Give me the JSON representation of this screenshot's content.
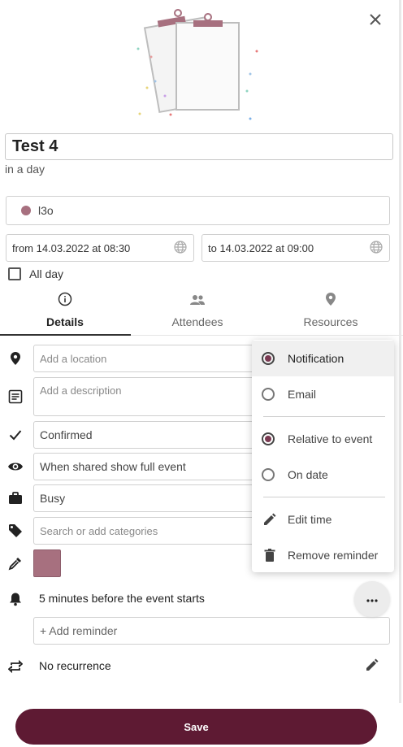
{
  "event": {
    "title": "Test 4",
    "relative_time": "in a day",
    "calendar_name": "l3o",
    "calendar_color": "#a7707f",
    "from": "from 14.03.2022 at 08:30",
    "to": "to 14.03.2022 at 09:00",
    "all_day_label": "All day"
  },
  "tabs": [
    {
      "label": "Details",
      "icon": "info-icon",
      "active": true
    },
    {
      "label": "Attendees",
      "icon": "people-icon",
      "active": false
    },
    {
      "label": "Resources",
      "icon": "location-pin-icon",
      "active": false
    }
  ],
  "details": {
    "location_placeholder": "Add a location",
    "description_placeholder": "Add a description",
    "status": "Confirmed",
    "visibility": "When shared show full event",
    "availability": "Busy",
    "categories_placeholder": "Search or add categories",
    "color": "#a7707f",
    "reminder": "5 minutes before the event starts",
    "add_reminder": "+ Add reminder",
    "recurrence": "No recurrence"
  },
  "menu": {
    "items": [
      {
        "label": "Notification",
        "type": "radio",
        "checked": true
      },
      {
        "label": "Email",
        "type": "radio",
        "checked": false
      },
      {
        "label": "Relative to event",
        "type": "radio",
        "checked": true
      },
      {
        "label": "On date",
        "type": "radio",
        "checked": false
      },
      {
        "label": "Edit time",
        "type": "action",
        "icon": "pencil-icon"
      },
      {
        "label": "Remove reminder",
        "type": "action",
        "icon": "trash-icon"
      }
    ]
  },
  "footer": {
    "save_label": "Save",
    "brand_color": "#5e1a33"
  }
}
